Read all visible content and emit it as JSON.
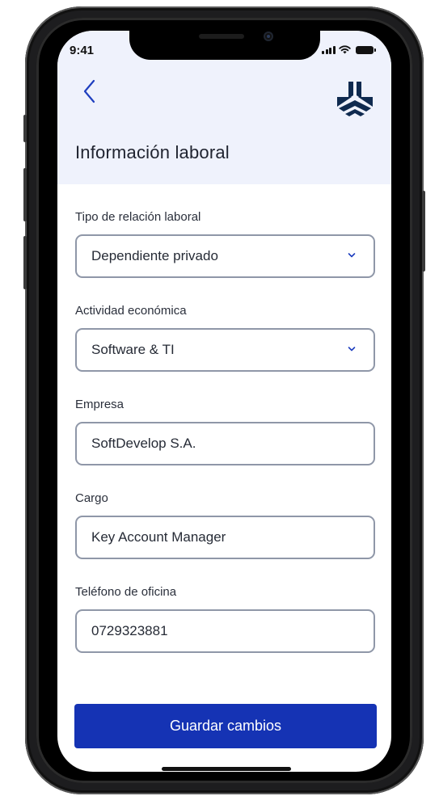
{
  "status_bar": {
    "time": "9:41"
  },
  "header": {
    "title": "Información laboral"
  },
  "form": {
    "relationship_type": {
      "label": "Tipo de relación laboral",
      "value": "Dependiente privado"
    },
    "economic_activity": {
      "label": "Actividad económica",
      "value": "Software & TI"
    },
    "company": {
      "label": "Empresa",
      "value": "SoftDevelop S.A."
    },
    "position": {
      "label": "Cargo",
      "value": "Key Account Manager"
    },
    "office_phone": {
      "label": "Teléfono de oficina",
      "value": "0729323881"
    }
  },
  "actions": {
    "save_label": "Guardar cambios"
  },
  "icons": {
    "back": "chevron-left-icon",
    "logo": "brand-logo",
    "dropdown": "chevron-down-icon",
    "signal": "signal-icon",
    "wifi": "wifi-icon",
    "battery": "battery-icon"
  },
  "colors": {
    "accent": "#1533b4",
    "header_bg": "#eff2fc",
    "field_border": "#8f97a8",
    "logo": "#0f2a4f"
  }
}
